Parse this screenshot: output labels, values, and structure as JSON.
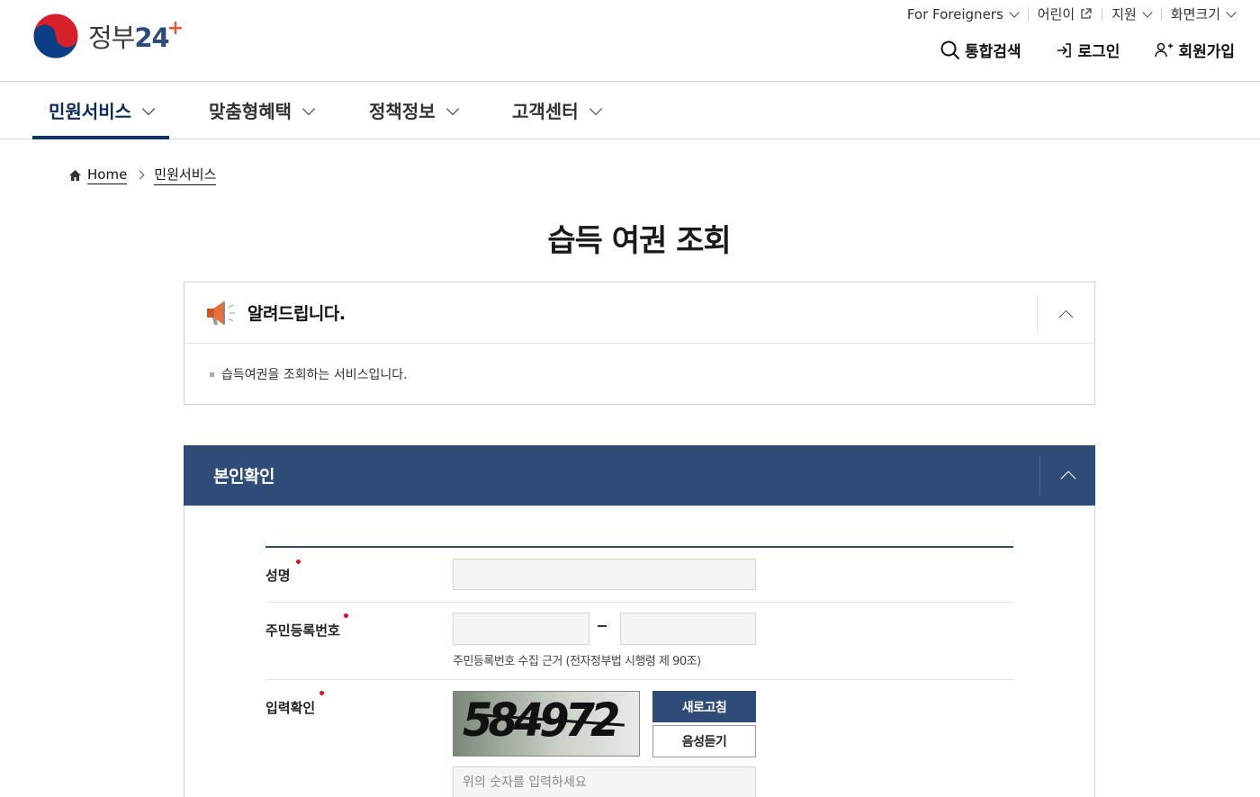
{
  "logo": {
    "text_kr": "정부",
    "text_num": "24",
    "text_plus": "+"
  },
  "utility": [
    {
      "label": "For Foreigners",
      "icon": "chevron-down-icon"
    },
    {
      "label": "어린이",
      "icon": "external-link-icon"
    },
    {
      "label": "지원",
      "icon": "chevron-down-icon"
    },
    {
      "label": "화면크기",
      "icon": "chevron-down-icon"
    }
  ],
  "quick": {
    "search": "통합검색",
    "login": "로그인",
    "signup": "회원가입"
  },
  "gnb": [
    {
      "label": "민원서비스",
      "active": true
    },
    {
      "label": "맞춤형혜택",
      "active": false
    },
    {
      "label": "정책정보",
      "active": false
    },
    {
      "label": "고객센터",
      "active": false
    }
  ],
  "breadcrumb": {
    "home": "Home",
    "current": "민원서비스"
  },
  "page_title": "습득 여권 조회",
  "notice": {
    "title": "알려드립니다.",
    "text": "습득여권을 조회하는 서비스입니다."
  },
  "identity": {
    "title": "본인확인",
    "fields": {
      "name_label": "성명",
      "rrn_label": "주민등록번호",
      "rrn_hint": "주민등록번호 수집 근거 (전자정부법 시행령 제 90조)",
      "captcha_label": "입력확인",
      "captcha_value": "584972",
      "refresh_label": "새로고침",
      "voice_label": "음성듣기",
      "captcha_placeholder": "위의 숫자를 입력하세요"
    }
  },
  "colors": {
    "primary": "#2f4b78",
    "gnb_active": "#0b3471",
    "required": "#d9121e"
  }
}
